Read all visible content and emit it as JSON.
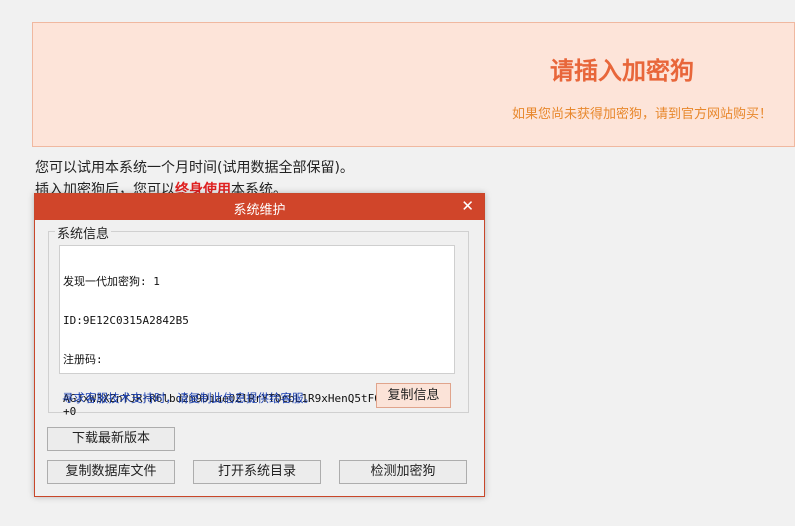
{
  "banner": {
    "title": "请插入加密狗",
    "subtitle": "如果您尚未获得加密狗，请到官方网站购买！"
  },
  "notice": {
    "trial": "您可以试用本系统一个月时间(试用数据全部保留)。",
    "insert_prefix": "插入加密狗后，您可以",
    "insert_highlight": "终身使用",
    "insert_suffix": "本系统。"
  },
  "dialog": {
    "title": "系统维护",
    "close_glyph": "✕",
    "group_label": "系统信息",
    "info_lines": [
      "发现一代加密狗: 1",
      "ID:9E12C0315A2842B5",
      "注册码:",
      "AGJxW3XZnYJRrR6lbd2m9Diae0ZlRrYTOcbL1R9xHenQ5tF0763M9aBuOf+0"
    ],
    "hint": "寻求客服技术支持时，请复制此信息提供给客服。",
    "copy_button": "复制信息",
    "download_button": "下载最新版本",
    "copy_db_button": "复制数据库文件",
    "open_dir_button": "打开系统目录",
    "detect_button": "检测加密狗"
  },
  "colors": {
    "banner_bg": "#fde4d9",
    "banner_title": "#e8663a",
    "titlebar": "#d0452a",
    "highlight": "#e02020",
    "hint": "#1a3fb0"
  }
}
